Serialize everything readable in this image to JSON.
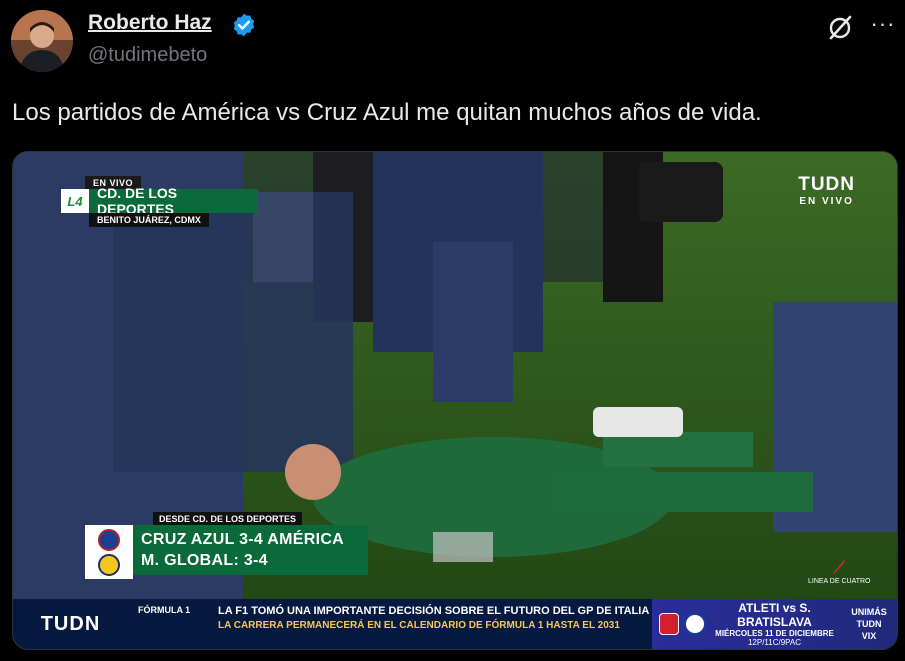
{
  "author": {
    "name": "Roberto Haz",
    "handle": "@tudimebeto",
    "verified": true,
    "accent_color": "#1d9bf0"
  },
  "header_actions": {
    "grok_icon": "grok-slash-circle-icon",
    "more_icon": "more-horizontal-icon",
    "more_glyph": "···"
  },
  "tweet": {
    "text": "Los partidos de América vs Cruz Azul me quitan muchos años de vida."
  },
  "media": {
    "description_icons": [
      "tudn-logo",
      "score-crests"
    ],
    "broadcast": {
      "live_tag": "EN VIVO",
      "venue_logo": "L4",
      "venue_name": "CD. DE LOS DEPORTES",
      "venue_location": "BENITO JUÁREZ, CDMX",
      "tudn_brand": "TUDN",
      "tudn_sub": "EN VIVO",
      "score_source": "DESDE CD. DE LOS DEPORTES",
      "score_line_1": "CRUZ AZUL 3-4 AMÉRICA",
      "score_line_2": "M. GLOBAL: 3-4",
      "corner_logo_text": "LINEA DE CUATRO",
      "ticker_brand": "TUDN",
      "ticker_category": "FÓRMULA 1",
      "ticker_headline": "LA F1 TOMÓ UNA IMPORTANTE DECISIÓN SOBRE EL FUTURO DEL GP DE ITALIA",
      "ticker_subline": "LA CARRERA PERMANECERÁ EN EL CALENDARIO DE FÓRMULA 1 HASTA EL 2031",
      "promo_match": "ATLETI vs S. BRATISLAVA",
      "promo_date": "MIÉRCOLES 11 DE DICIEMBRE",
      "promo_time": "12P/11C/9PAC",
      "promo_channels": "UNIMÁS\nTUDN\nVIX"
    }
  },
  "colors": {
    "background": "#000000",
    "text_primary": "#e7e9ea",
    "text_secondary": "#71767b",
    "broadcast_green": "#0b6a3a",
    "ticker_navy": "#061a40"
  }
}
